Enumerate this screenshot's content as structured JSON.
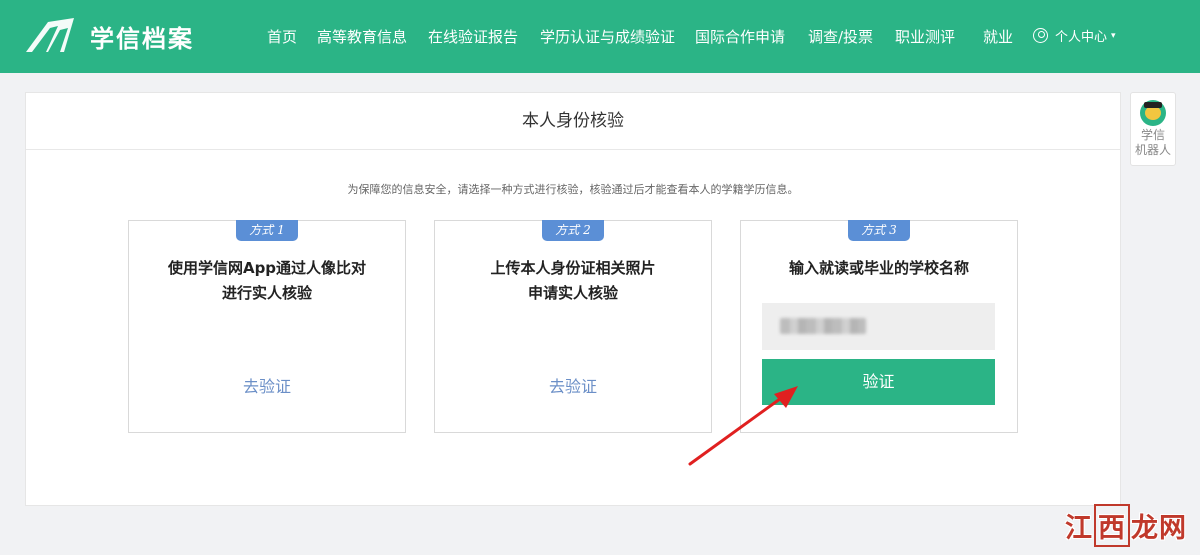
{
  "brand": {
    "name": "学信档案"
  },
  "nav": {
    "items": [
      "首页",
      "高等教育信息",
      "在线验证报告",
      "学历认证与成绩验证",
      "国际合作申请",
      "调查/投票",
      "职业测评",
      "就业"
    ],
    "user_menu": "个人中心"
  },
  "page": {
    "title": "本人身份核验",
    "notice": "为保障您的信息安全，请选择一种方式进行核验，核验通过后才能查看本人的学籍学历信息。"
  },
  "methods": [
    {
      "badge": "方式 1",
      "title_line1": "使用学信网App通过人像比对",
      "title_line2": "进行实人核验",
      "link": "去验证"
    },
    {
      "badge": "方式 2",
      "title_line1": "上传本人身份证相关照片",
      "title_line2": "申请实人核验",
      "link": "去验证"
    },
    {
      "badge": "方式 3",
      "title_line1": "输入就读或毕业的学校名称",
      "input_value": "",
      "button": "验证"
    }
  ],
  "robot": {
    "line1": "学信",
    "line2": "机器人"
  },
  "watermark": {
    "c1": "江",
    "c2": "西",
    "c3": "龙网"
  },
  "colors": {
    "brand_green": "#2bb486",
    "badge_blue": "#5b8fd6",
    "link_blue": "#6b8fc7",
    "arrow_red": "#e02020"
  }
}
